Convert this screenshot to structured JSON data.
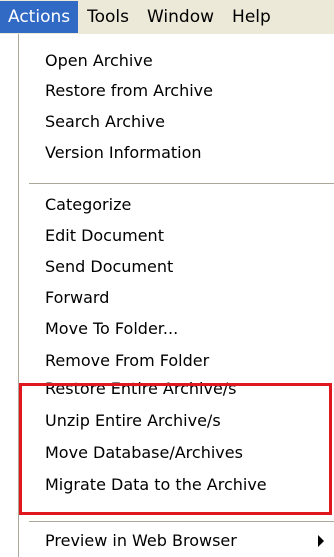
{
  "menubar": {
    "items": [
      {
        "label": "Actions",
        "active": true
      },
      {
        "label": "Tools",
        "active": false
      },
      {
        "label": "Window",
        "active": false
      },
      {
        "label": "Help",
        "active": false
      }
    ]
  },
  "menu": {
    "group1": [
      "Open Archive",
      "Restore from Archive",
      "Search Archive",
      "Version Information"
    ],
    "group2": [
      "Categorize",
      "Edit Document",
      "Send Document",
      "Forward",
      "Move To Folder...",
      "Remove From Folder"
    ],
    "highlighted": [
      "Restore Entire Archive/s",
      "Unzip Entire Archive/s",
      "Move Database/Archives",
      "Migrate Data to the Archive"
    ],
    "group3": [
      "Preview in Web Browser"
    ]
  },
  "colors": {
    "active_menu_bg": "#316ac5",
    "highlight_border": "#e0171c"
  }
}
